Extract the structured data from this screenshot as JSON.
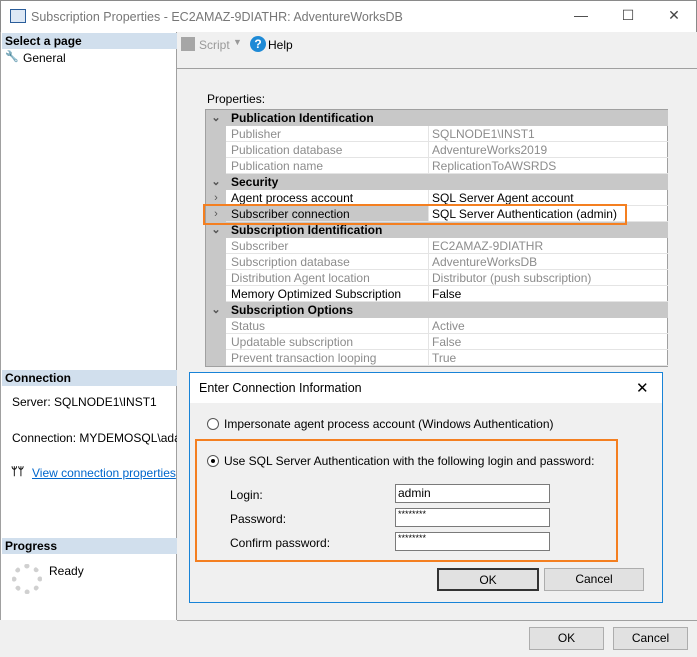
{
  "window": {
    "title": "Subscription Properties - EC2AMAZ-9DIATHR: AdventureWorksDB",
    "minimize": "—",
    "maximize": "☐",
    "close": "✕"
  },
  "left": {
    "select_page": "Select a page",
    "pages": [
      {
        "label": "General",
        "icon": "wrench-icon"
      }
    ],
    "connection_header": "Connection",
    "server": "Server: SQLNODE1\\INST1",
    "connection": "Connection: MYDEMOSQL\\adadmin",
    "view_props": "View connection properties",
    "progress_header": "Progress",
    "progress_status": "Ready"
  },
  "toolbar": {
    "script": "Script",
    "help": "Help"
  },
  "properties_label": "Properties:",
  "grid": [
    {
      "group": "Publication Identification",
      "rows": [
        {
          "name": "Publisher",
          "value": "SQLNODE1\\INST1",
          "readonly": true
        },
        {
          "name": "Publication database",
          "value": "AdventureWorks2019",
          "readonly": true
        },
        {
          "name": "Publication name",
          "value": "ReplicationToAWSRDS",
          "readonly": true
        }
      ]
    },
    {
      "group": "Security",
      "rows": [
        {
          "name": "Agent process account",
          "value": "SQL Server Agent account",
          "readonly": false,
          "expand": true
        },
        {
          "name": "Subscriber connection",
          "value": "SQL Server Authentication (admin)",
          "readonly": false,
          "expand": true,
          "selected": true
        }
      ]
    },
    {
      "group": "Subscription Identification",
      "rows": [
        {
          "name": "Subscriber",
          "value": "EC2AMAZ-9DIATHR",
          "readonly": true
        },
        {
          "name": "Subscription database",
          "value": "AdventureWorksDB",
          "readonly": true
        },
        {
          "name": "Distribution Agent location",
          "value": "Distributor (push subscription)",
          "readonly": true
        },
        {
          "name": "Memory Optimized Subscription",
          "value": "False",
          "readonly": false
        }
      ]
    },
    {
      "group": "Subscription Options",
      "rows": [
        {
          "name": "Status",
          "value": "Active",
          "readonly": true
        },
        {
          "name": "Updatable subscription",
          "value": "False",
          "readonly": true
        },
        {
          "name": "Prevent transaction looping",
          "value": "True",
          "readonly": true
        }
      ]
    }
  ],
  "footer": {
    "ok": "OK",
    "cancel": "Cancel"
  },
  "dialog": {
    "title": "Enter Connection Information",
    "close": "✕",
    "option_windows": "Impersonate agent process account (Windows Authentication)",
    "option_sql": "Use SQL Server Authentication with the following login and password:",
    "selected_option": "sql",
    "login_label": "Login:",
    "login_value": "admin",
    "password_label": "Password:",
    "password_value": "********",
    "confirm_label": "Confirm password:",
    "confirm_value": "********",
    "ok": "OK",
    "cancel": "Cancel"
  },
  "colors": {
    "highlight": "#f47f20",
    "accent": "#1883d7",
    "header_bg": "#d1dfed"
  }
}
